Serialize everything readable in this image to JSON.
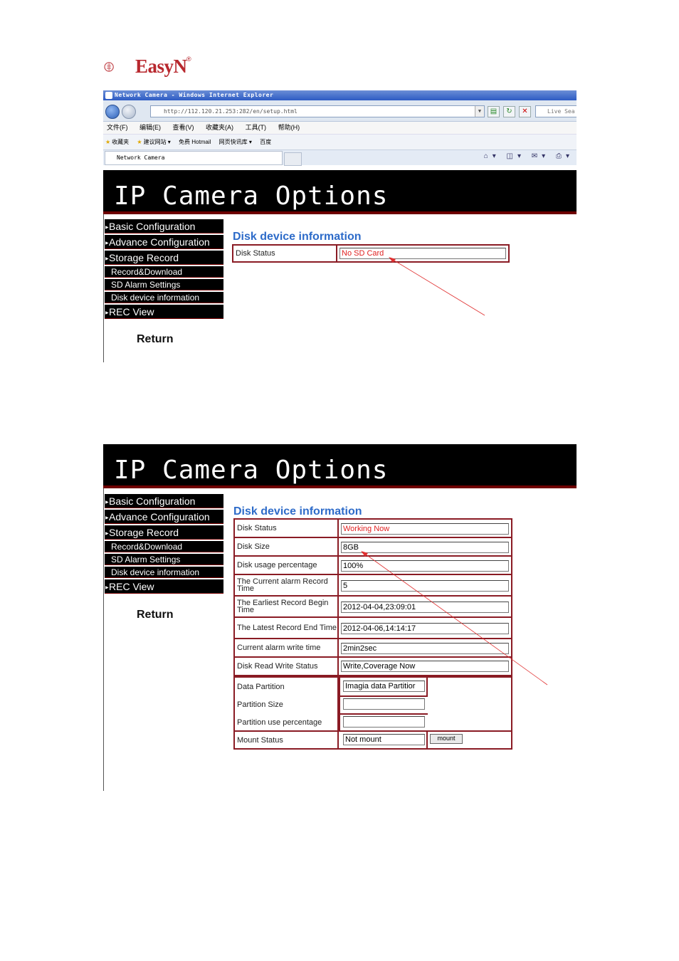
{
  "logo": {
    "brand": "EasyN",
    "reg": "®"
  },
  "browser": {
    "title": "Network Camera - Windows Internet Explorer",
    "address": "http://112.120.21.253:282/en/setup.html",
    "search_box": "Live Sea",
    "menu": [
      "文件(F)",
      "编辑(E)",
      "查看(V)",
      "收藏夹(A)",
      "工具(T)",
      "帮助(H)"
    ],
    "favorites": [
      "收藏夹",
      "建议网站 ▾",
      "免费 Hotmail",
      "网页快讯库 ▾",
      "百度"
    ],
    "tab": "Network Camera"
  },
  "panel1": {
    "banner": "IP Camera Options",
    "menu": [
      "Basic Configuration",
      "Advance Configuration",
      "Storage Record"
    ],
    "submenu": [
      "Record&Download",
      "SD Alarm Settings",
      "Disk device information"
    ],
    "menu_last": "REC View",
    "return": "Return",
    "heading": "Disk device information",
    "rows": [
      {
        "label": "Disk Status",
        "value": "No SD Card"
      }
    ]
  },
  "panel2": {
    "banner": "IP Camera Options",
    "menu": [
      "Basic Configuration",
      "Advance Configuration",
      "Storage Record"
    ],
    "submenu": [
      "Record&Download",
      "SD Alarm Settings",
      "Disk device information"
    ],
    "menu_last": "REC View",
    "return": "Return",
    "heading": "Disk device information",
    "rows": [
      {
        "label": "Disk Status",
        "value": "Working Now"
      },
      {
        "label": "Disk Size",
        "value": "8GB"
      },
      {
        "label": "Disk usage percentage",
        "value": "100%"
      },
      {
        "label": "The Current alarm Record Time",
        "value": "5"
      },
      {
        "label": "The Earliest Record Begin Time",
        "value": "2012-04-04,23:09:01"
      },
      {
        "label": "The Latest Record End Time",
        "value": "2012-04-06,14:14:17"
      },
      {
        "label": "Current alarm write time",
        "value": "2min2sec"
      },
      {
        "label": "Disk Read Write Status",
        "value": "Write,Coverage Now"
      }
    ],
    "rows2": [
      {
        "label": "Data Partition",
        "value": "Imagia data Partitior"
      },
      {
        "label": "Partition Size",
        "value": ""
      },
      {
        "label": "Partition use percentage",
        "value": ""
      },
      {
        "label": "Mount Status",
        "value": "Not mount"
      }
    ],
    "mount_button": "mount"
  },
  "colors": {
    "table_border": "#8a1b24",
    "heading": "#2d6bc9",
    "status_red": "#e02020"
  }
}
